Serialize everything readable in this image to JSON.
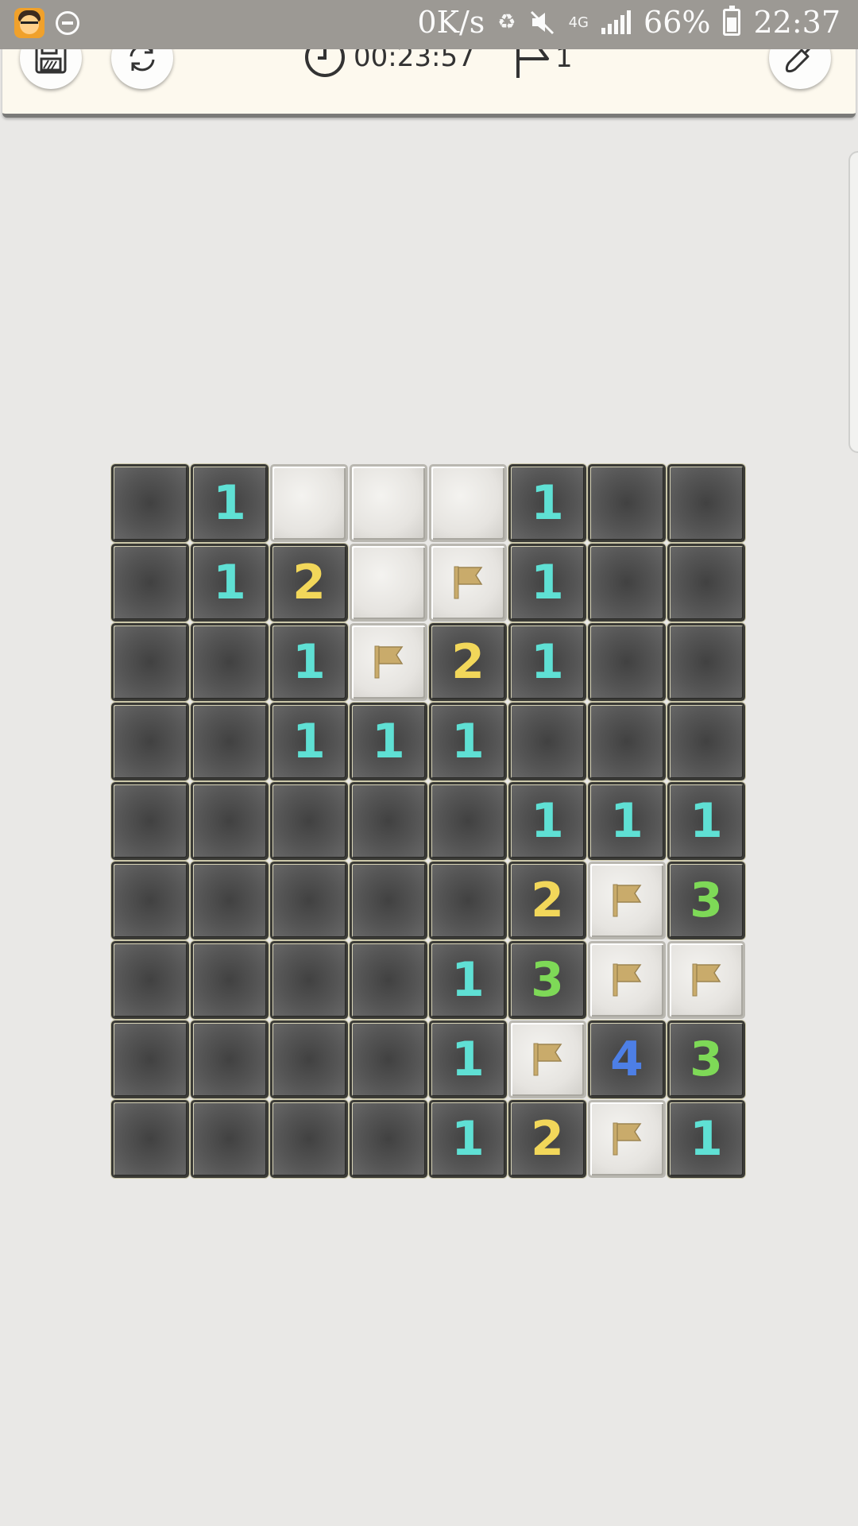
{
  "status_bar": {
    "net_speed": "0K/s",
    "network_type": "4G",
    "battery": "66%",
    "time": "22:37",
    "icons": [
      "app-avatar-icon",
      "do-not-disturb-icon",
      "battery-saver-icon",
      "mute-icon",
      "signal-icon",
      "battery-icon"
    ]
  },
  "toolbar": {
    "timer": "00:23:57",
    "flags_count": "1",
    "buttons": [
      "save-icon",
      "restart-icon",
      "shovel-icon"
    ]
  },
  "board": {
    "columns": 8,
    "rows": 9,
    "legend": {
      "H": "hidden",
      "F": "flag",
      "0": "empty revealed",
      "1-8": "mine count"
    },
    "grid": [
      [
        "0",
        "1",
        "H",
        "H",
        "H",
        "1",
        "0",
        "0"
      ],
      [
        "0",
        "1",
        "2",
        "H",
        "F",
        "1",
        "0",
        "0"
      ],
      [
        "0",
        "0",
        "1",
        "F",
        "2",
        "1",
        "0",
        "0"
      ],
      [
        "0",
        "0",
        "1",
        "1",
        "1",
        "0",
        "0",
        "0"
      ],
      [
        "0",
        "0",
        "0",
        "0",
        "0",
        "1",
        "1",
        "1"
      ],
      [
        "0",
        "0",
        "0",
        "0",
        "0",
        "2",
        "F",
        "3"
      ],
      [
        "0",
        "0",
        "0",
        "0",
        "1",
        "3",
        "F",
        "F"
      ],
      [
        "0",
        "0",
        "0",
        "0",
        "1",
        "F",
        "4",
        "3"
      ],
      [
        "0",
        "0",
        "0",
        "0",
        "1",
        "2",
        "F",
        "1"
      ]
    ],
    "number_colors": {
      "1": "#5fe0d4",
      "2": "#f2d75a",
      "3": "#7ed957",
      "4": "#4d7fe6"
    },
    "flag_color": "#c9ab6b"
  }
}
